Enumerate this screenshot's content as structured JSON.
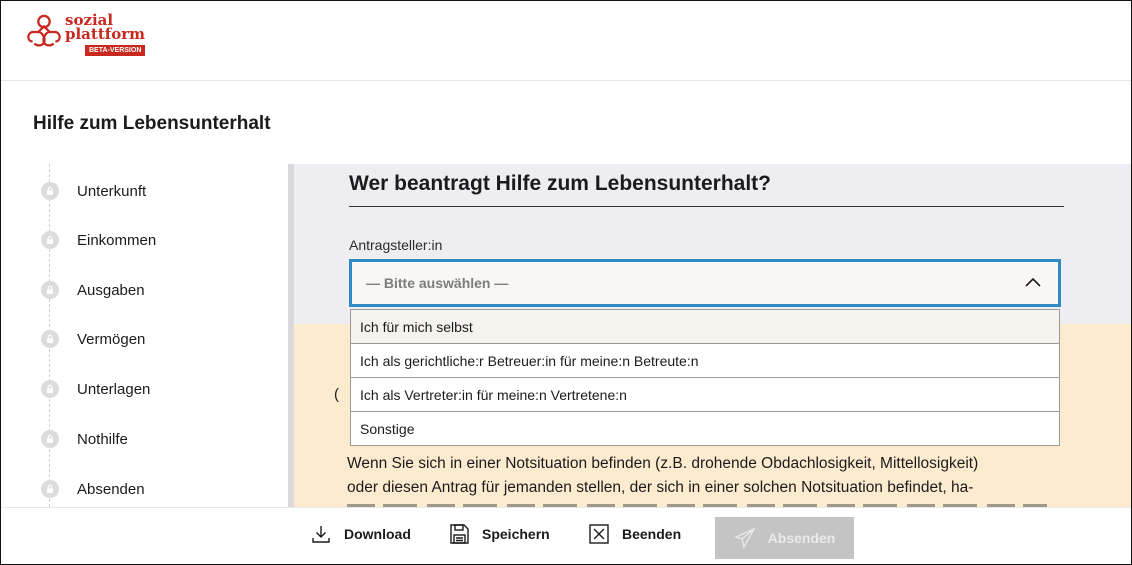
{
  "brand": {
    "line1": "sozial",
    "line2": "plattform",
    "badge": "BETA-VERSION",
    "color": "#c8281e"
  },
  "page": {
    "title": "Hilfe zum Lebensunterhalt"
  },
  "sidebar": {
    "items": [
      {
        "label": "Unterkunft",
        "icon": "lock-icon"
      },
      {
        "label": "Einkommen",
        "icon": "lock-icon"
      },
      {
        "label": "Ausgaben",
        "icon": "lock-icon"
      },
      {
        "label": "Vermögen",
        "icon": "lock-icon"
      },
      {
        "label": "Unterlagen",
        "icon": "lock-icon"
      },
      {
        "label": "Nothilfe",
        "icon": "lock-icon"
      },
      {
        "label": "Absenden",
        "icon": "lock-icon"
      }
    ]
  },
  "form": {
    "question": "Wer beantragt Hilfe zum Lebensunterhalt?",
    "field_label": "Antragsteller:in",
    "select_value": "— Bitte auswählen —",
    "options": [
      "Ich für mich selbst",
      "Ich als gerichtliche:r Betreuer:in für meine:n Betreute:n",
      "Ich als Vertreter:in für meine:n Vertretene:n",
      "Sonstige"
    ],
    "accent_color": "#2e8bc4"
  },
  "notice": {
    "fragment": "(",
    "line1": "Wenn Sie sich in einer Notsituation befinden (z.B. drohende Obdachlosigkeit, Mittellosigkeit)",
    "line2": "oder diesen Antrag für jemanden stellen, der sich in einer solchen Notsituation befindet, ha-",
    "background": "#fdebd0"
  },
  "toolbar": {
    "download": "Download",
    "save": "Speichern",
    "quit": "Beenden",
    "send": "Absenden"
  }
}
